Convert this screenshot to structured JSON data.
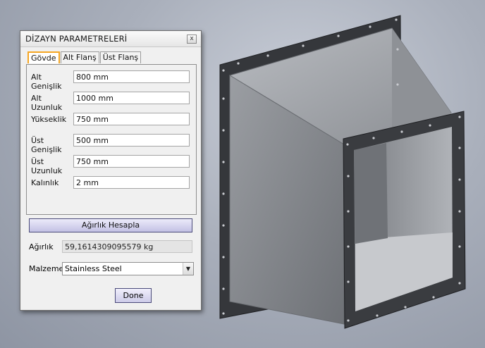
{
  "dialog": {
    "title": "DİZAYN PARAMETRELERİ",
    "close_glyph": "x",
    "tabs": [
      {
        "label": "Gövde",
        "active": true
      },
      {
        "label": "Alt Flanş",
        "active": false
      },
      {
        "label": "Üst Flanş",
        "active": false
      }
    ],
    "fields": [
      {
        "label": "Alt Genişlik",
        "value": "800 mm"
      },
      {
        "label": "Alt Uzunluk",
        "value": "1000 mm"
      },
      {
        "label": "Yükseklik",
        "value": "750 mm"
      },
      {
        "label": "Üst Genişlik",
        "value": "500 mm"
      },
      {
        "label": "Üst Uzunluk",
        "value": "750 mm"
      },
      {
        "label": "Kalınlık",
        "value": "2 mm"
      }
    ],
    "calc_button": "Ağırlık Hesapla",
    "weight": {
      "label": "Ağırlık",
      "value": "59,1614309095579 kg"
    },
    "material": {
      "label": "Malzeme",
      "value": "Stainless Steel"
    },
    "done_button": "Done"
  },
  "model": {
    "name": "square-to-offset-rectangle-transition-duct",
    "icon": "3d-duct-model",
    "colors": {
      "body": "#8f9297",
      "flange": "#3a3c40",
      "background": "#a9afbb"
    }
  }
}
